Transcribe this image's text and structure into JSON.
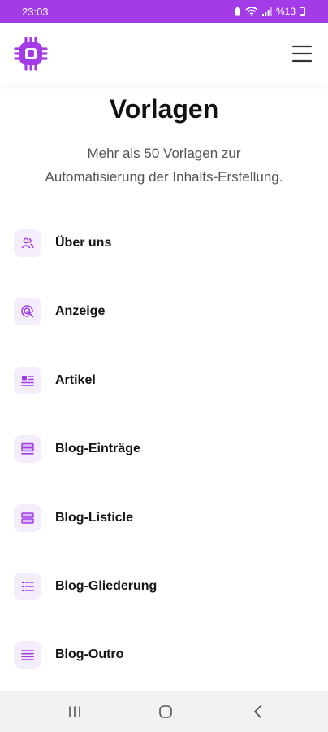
{
  "status_bar": {
    "time": "23:03",
    "battery_text": "%13",
    "icons": [
      "battery-saver-icon",
      "wifi-icon",
      "signal-icon",
      "battery-icon"
    ]
  },
  "header": {
    "logo_icon": "chip-logo-icon",
    "menu_icon": "hamburger-menu-icon"
  },
  "page": {
    "title": "Vorlagen",
    "subtitle_line1": "Mehr als 50 Vorlagen zur",
    "subtitle_line2": "Automatisierung der Inhalts-Erstellung."
  },
  "templates": [
    {
      "label": "Über uns",
      "icon": "users-icon"
    },
    {
      "label": "Anzeige",
      "icon": "target-click-icon"
    },
    {
      "label": "Artikel",
      "icon": "article-icon"
    },
    {
      "label": "Blog-Einträge",
      "icon": "stack-rows-icon"
    },
    {
      "label": "Blog-Listicle",
      "icon": "two-rows-icon"
    },
    {
      "label": "Blog-Gliederung",
      "icon": "bullet-list-icon"
    },
    {
      "label": "Blog-Outro",
      "icon": "lines-icon"
    }
  ],
  "nav": {
    "recents_icon": "recents-icon",
    "home_icon": "home-icon",
    "back_icon": "back-icon"
  },
  "colors": {
    "accent": "#a33ce6",
    "icon_bg": "#f4eefc",
    "nav_bg": "#f2f2f2"
  }
}
